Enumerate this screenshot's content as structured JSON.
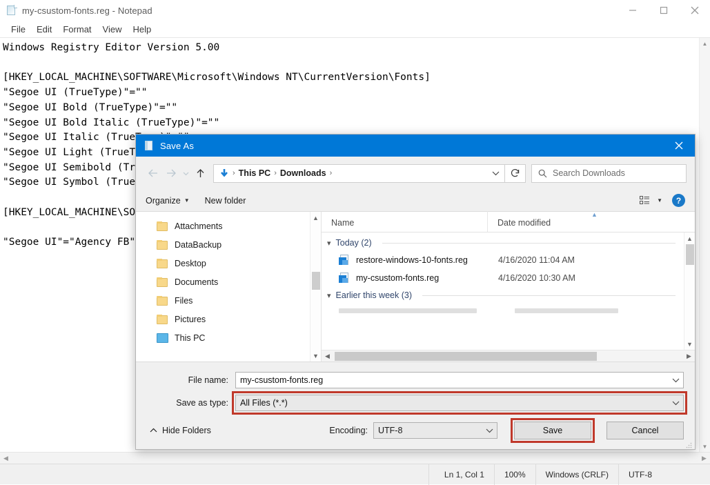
{
  "notepad": {
    "title": "my-csustom-fonts.reg - Notepad",
    "icon": "notepad-document-icon",
    "window_controls": [
      {
        "name": "minimize",
        "glyph": "minimize-icon"
      },
      {
        "name": "maximize",
        "glyph": "maximize-icon"
      },
      {
        "name": "close",
        "glyph": "close-icon"
      }
    ],
    "menus": [
      "File",
      "Edit",
      "Format",
      "View",
      "Help"
    ],
    "text_lines": [
      "Windows Registry Editor Version 5.00",
      "",
      "[HKEY_LOCAL_MACHINE\\SOFTWARE\\Microsoft\\Windows NT\\CurrentVersion\\Fonts]",
      "\"Segoe UI (TrueType)\"=\"\"",
      "\"Segoe UI Bold (TrueType)\"=\"\"",
      "\"Segoe UI Bold Italic (TrueType)\"=\"\"",
      "\"Segoe UI Italic (TrueType)\"=\"\"",
      "\"Segoe UI Light (TrueType)\"=\"\"",
      "\"Segoe UI Semibold (TrueType)\"=\"\"",
      "\"Segoe UI Symbol (TrueType)\"=\"\"",
      "",
      "[HKEY_LOCAL_MACHINE\\SOFTWARE\\Microsoft\\Windows NT\\CurrentVersion\\Fonts]",
      "",
      "\"Segoe UI\"=\"Agency FB\""
    ],
    "status_bar": {
      "position": "Ln 1, Col 1",
      "zoom": "100%",
      "line_endings": "Windows (CRLF)",
      "encoding": "UTF-8"
    }
  },
  "save_dialog": {
    "title": "Save As",
    "title_icon": "notepad-document-icon",
    "close_label": "close-icon",
    "nav": {
      "back": "back-arrow-icon",
      "forward": "forward-arrow-icon",
      "recent": "recent-locations-icon",
      "up": "up-arrow-icon",
      "address_icon": "downloads-arrow-icon",
      "breadcrumbs": [
        "This PC",
        "Downloads"
      ],
      "address_chevron": "chevron-down-icon",
      "refresh": "refresh-icon",
      "search_placeholder": "Search Downloads",
      "search_icon": "search-icon"
    },
    "toolbar": {
      "organize": "Organize",
      "new_folder": "New folder",
      "view_icon": "view-layout-icon",
      "view_caret": "chevron-down-icon",
      "help": "?"
    },
    "tree_items": [
      {
        "label": "Attachments",
        "icon": "folder-icon"
      },
      {
        "label": "DataBackup",
        "icon": "folder-icon"
      },
      {
        "label": "Desktop",
        "icon": "folder-icon"
      },
      {
        "label": "Documents",
        "icon": "folder-icon"
      },
      {
        "label": "Files",
        "icon": "folder-icon"
      },
      {
        "label": "Pictures",
        "icon": "folder-icon"
      },
      {
        "label": "This PC",
        "icon": "this-pc-icon"
      }
    ],
    "columns": [
      "Name",
      "Date modified"
    ],
    "groups": [
      {
        "label": "Today (2)",
        "files": [
          {
            "name": "restore-windows-10-fonts.reg",
            "date": "4/16/2020 11:04 AM",
            "icon": "registry-file-icon"
          },
          {
            "name": "my-csustom-fonts.reg",
            "date": "4/16/2020 10:30 AM",
            "icon": "registry-file-icon"
          }
        ]
      },
      {
        "label": "Earlier this week (3)",
        "files": []
      }
    ],
    "form": {
      "file_name_label": "File name:",
      "file_name_value": "my-csustom-fonts.reg",
      "save_as_type_label": "Save as type:",
      "save_as_type_value": "All Files  (*.*)"
    },
    "footer": {
      "hide_folders": "Hide Folders",
      "hide_folders_icon": "chevron-up-icon",
      "encoding_label": "Encoding:",
      "encoding_value": "UTF-8",
      "save": "Save",
      "cancel": "Cancel"
    },
    "highlight_color": "#c0392b",
    "accent_color": "#0078d7"
  }
}
